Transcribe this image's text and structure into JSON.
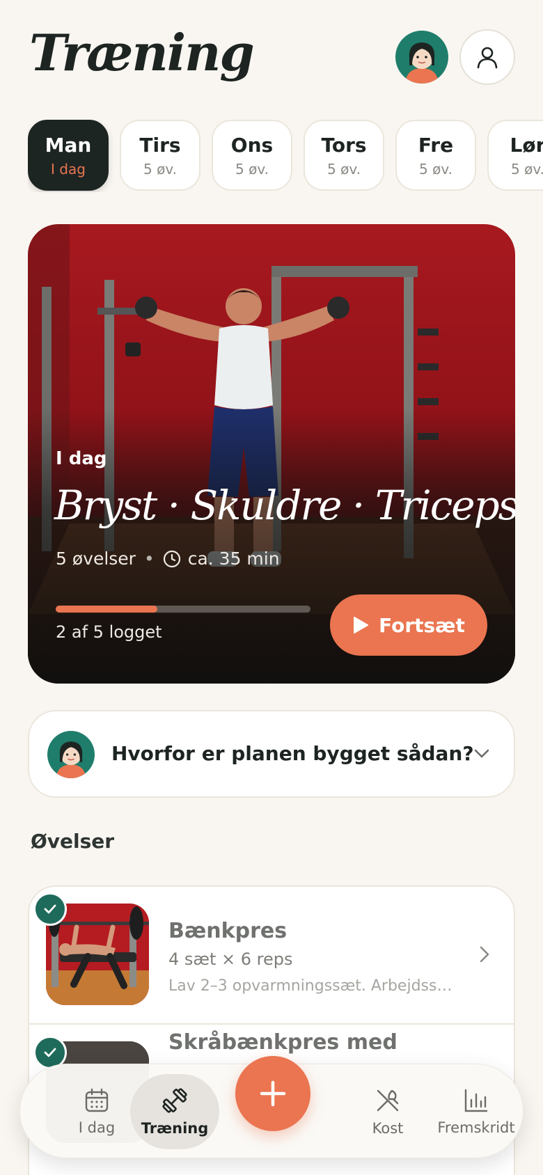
{
  "header": {
    "title": "Træning",
    "coach_avatar_icon": "coach-avatar",
    "profile_icon": "user-icon"
  },
  "days": [
    {
      "name": "Man",
      "sub": "I dag",
      "active": true
    },
    {
      "name": "Tirs",
      "sub": "5 øv."
    },
    {
      "name": "Ons",
      "sub": "5 øv."
    },
    {
      "name": "Tors",
      "sub": "5 øv."
    },
    {
      "name": "Fre",
      "sub": "5 øv."
    },
    {
      "name": "Lør",
      "sub": "5 øv."
    }
  ],
  "hero": {
    "eyebrow": "I dag",
    "title": "Bryst · Skuldre · Triceps",
    "exercises": "5 øvelser",
    "separator": "•",
    "duration": "ca. 35 min",
    "progress": 0.4,
    "progress_label": "2 af 5 logget",
    "continue_label": "Fortsæt"
  },
  "why": {
    "text": "Hvorfor er planen bygget sådan?"
  },
  "exercises_section": {
    "title": "Øvelser",
    "items": [
      {
        "name": "Bænkpres",
        "sets": "4 sæt × 6 reps",
        "note": "Lav 2–3 opvarmningssæt. Arbejdss…",
        "done": true
      },
      {
        "name": "Skråbænkpres med",
        "done": true
      }
    ]
  },
  "nav": {
    "items": [
      {
        "label": "I dag",
        "icon": "calendar-icon"
      },
      {
        "label": "Træning",
        "icon": "dumbbell-icon",
        "active": true
      },
      {
        "label": "Kost",
        "icon": "fork-knife-icon"
      },
      {
        "label": "Fremskridt",
        "icon": "bar-chart-icon"
      }
    ],
    "add_icon": "plus-icon"
  },
  "colors": {
    "accent": "#ea7550",
    "dark": "#1d2523",
    "teal": "#1f6b5b",
    "background": "#f9f6f1"
  }
}
